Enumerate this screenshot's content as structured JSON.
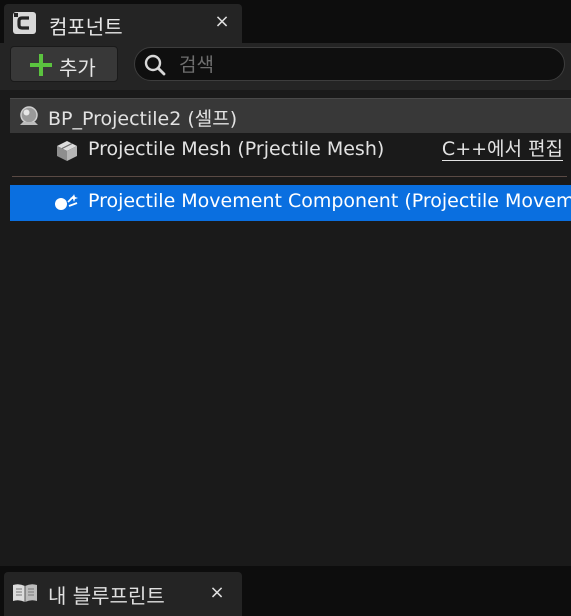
{
  "tab": {
    "title": "컴포넌트",
    "close": "×",
    "icon": "component-c-icon"
  },
  "toolbar": {
    "add_label": "추가",
    "add_icon": "plus-icon"
  },
  "search": {
    "placeholder": "검색",
    "value": "",
    "icon": "search-icon"
  },
  "tree": {
    "root": {
      "label": "BP_Projectile2 (셀프)",
      "icon": "actor-sphere-icon"
    },
    "items": [
      {
        "label": "Projectile Mesh (Prjectile Mesh)",
        "icon": "static-mesh-icon",
        "edit_label": "C++에서 편집",
        "selected": false
      },
      {
        "label": "Projectile Movement Component (Projectile Movement)",
        "icon": "movement-component-icon",
        "selected": true
      }
    ]
  },
  "bottom_tab": {
    "title": "내 블루프린트",
    "close": "×",
    "icon": "book-icon"
  },
  "colors": {
    "selection": "#0a6fe0",
    "accent_add": "#5bc33f",
    "background": "#1a1a1a"
  }
}
